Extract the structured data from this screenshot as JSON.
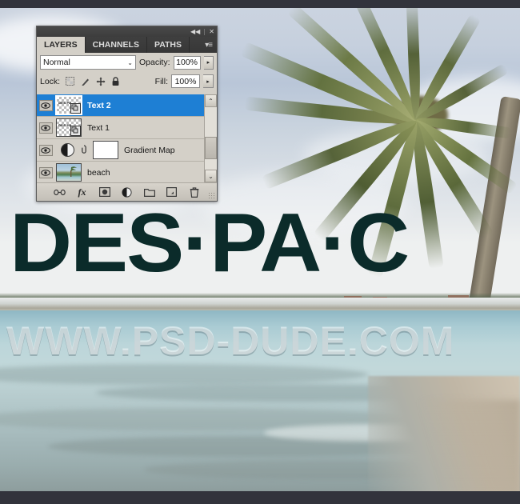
{
  "canvas": {
    "headline_text": "DES·PA·C",
    "headline_color": "#0b2b2a",
    "watermark_text": "WWW.PSD-DUDE.COM",
    "photo_description": "beach-palm-tree-photo"
  },
  "panel": {
    "titlebar": {
      "collapse_label": "◀◀",
      "close_label": "✕"
    },
    "tabs": [
      {
        "label": "LAYERS",
        "active": true
      },
      {
        "label": "CHANNELS",
        "active": false
      },
      {
        "label": "PATHS",
        "active": false
      }
    ],
    "menu_label": "▾≡",
    "blend": {
      "mode_value": "Normal",
      "chevron": "⌄",
      "opacity_label": "Opacity:",
      "opacity_value": "100%",
      "spinner": "▸"
    },
    "lock": {
      "label": "Lock:",
      "icons": [
        "transparent-pixels-lock-icon",
        "image-pixels-lock-icon",
        "position-lock-icon",
        "all-lock-icon"
      ],
      "fill_label": "Fill:",
      "fill_value": "100%",
      "spinner": "▸"
    },
    "layers": [
      {
        "name": "Text 2",
        "selected": true,
        "visible": true,
        "type": "text",
        "thumb_text": "DES PA"
      },
      {
        "name": "Text 1",
        "selected": false,
        "visible": true,
        "type": "text",
        "thumb_text": "DES PA"
      },
      {
        "name": "Gradient Map",
        "selected": false,
        "visible": true,
        "type": "adjustment",
        "thumb_text": ""
      },
      {
        "name": "beach",
        "selected": false,
        "visible": true,
        "type": "image",
        "thumb_text": ""
      }
    ],
    "scrollbar": {
      "up_arrow": "⌃",
      "down_arrow": "⌄"
    },
    "bottom_tools": [
      {
        "name": "link-layers-icon",
        "glyph": "⛓"
      },
      {
        "name": "layer-style-fx-icon",
        "glyph": "fx"
      },
      {
        "name": "add-layer-mask-icon",
        "glyph": "▣"
      },
      {
        "name": "new-adjustment-icon",
        "glyph": "◐"
      },
      {
        "name": "new-group-icon",
        "glyph": "▭"
      },
      {
        "name": "new-layer-icon",
        "glyph": "▤"
      },
      {
        "name": "delete-layer-icon",
        "glyph": "🗑"
      }
    ]
  }
}
